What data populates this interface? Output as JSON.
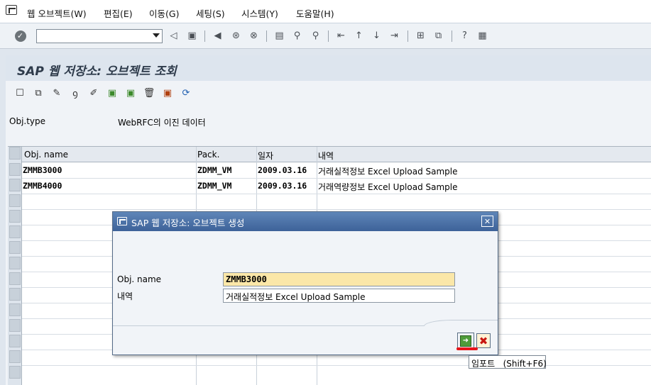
{
  "menu": {
    "items": [
      "웹 오브젝트(W)",
      "편집(E)",
      "이동(G)",
      "세팅(S)",
      "시스템(Y)",
      "도움말(H)"
    ]
  },
  "toolbar": {
    "icons": [
      "enter-icon",
      "command-field",
      "back-icon",
      "save-icon",
      "back-nav-icon",
      "exit-icon",
      "cancel-icon",
      "print-icon",
      "find-icon",
      "find-next-icon",
      "first-page-icon",
      "previous-page-icon",
      "next-page-icon",
      "last-page-icon",
      "new-session-icon",
      "shortcut-icon",
      "help-icon",
      "layout-icon"
    ]
  },
  "title": "SAP 웹 저장소: 오브젝트 조회",
  "fields": {
    "obj_type_label": "Obj.type",
    "obj_type_value": "WebRFC의 이진 데이터"
  },
  "table": {
    "headers": [
      "Obj. name",
      "Pack.",
      "일자",
      "내역"
    ],
    "rows": [
      {
        "name": "ZMMB3000",
        "pack": "ZDMM_VM",
        "date": "2009.03.16",
        "desc": "거래실적정보 Excel Upload Sample"
      },
      {
        "name": "ZMMB4000",
        "pack": "ZDMM_VM",
        "date": "2009.03.16",
        "desc": "거래역량정보 Excel Upload Sample"
      }
    ]
  },
  "dialog": {
    "title": "SAP 웹 저장소: 오브젝트 생성",
    "name_label": "Obj. name",
    "name_value": "ZMMB3000",
    "desc_label": "내역",
    "desc_value": "거래실적정보 Excel Upload Sample",
    "close_symbol": "✕",
    "import_symbol": "➜",
    "cancel_symbol": "✖"
  },
  "tooltip": "임포트   (Shift+F6)",
  "colors": {
    "dialog_title": "#3d6299",
    "key_field": "#fbe7a8",
    "import_button": "#4f9c3a",
    "cancel_icon": "#c8160f",
    "highlight_mark": "#e8141a"
  }
}
